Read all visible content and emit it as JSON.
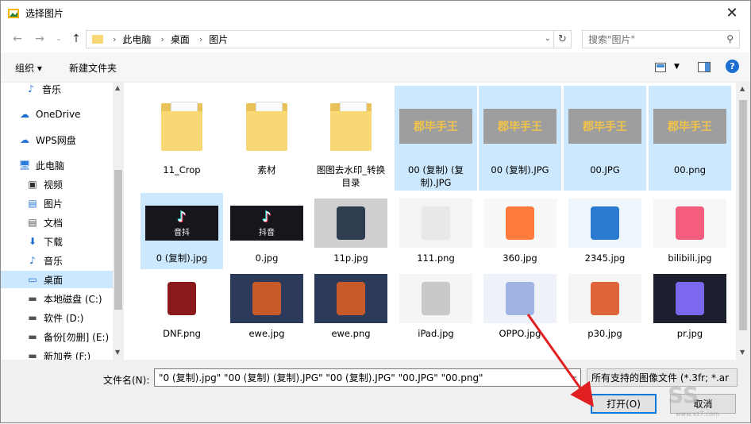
{
  "window": {
    "title": "选择图片"
  },
  "nav": {
    "breadcrumbs": [
      "此电脑",
      "桌面",
      "图片"
    ],
    "search_placeholder": "搜索\"图片\""
  },
  "toolbar": {
    "organize": "组织 ▾",
    "new_folder": "新建文件夹"
  },
  "sidebar": {
    "items": [
      {
        "label": "音乐",
        "icon": "music-icon"
      },
      {
        "label": "OneDrive",
        "icon": "cloud-icon"
      },
      {
        "label": "WPS网盘",
        "icon": "wps-cloud-icon"
      },
      {
        "label": "此电脑",
        "icon": "computer-icon"
      },
      {
        "label": "视频",
        "icon": "video-icon"
      },
      {
        "label": "图片",
        "icon": "pictures-icon"
      },
      {
        "label": "文档",
        "icon": "documents-icon"
      },
      {
        "label": "下载",
        "icon": "download-icon"
      },
      {
        "label": "音乐",
        "icon": "music-icon"
      },
      {
        "label": "桌面",
        "icon": "desktop-icon",
        "selected": true
      },
      {
        "label": "本地磁盘 (C:)",
        "icon": "drive-icon"
      },
      {
        "label": "软件 (D:)",
        "icon": "drive-icon"
      },
      {
        "label": "备份[勿删] (E:)",
        "icon": "drive-icon"
      },
      {
        "label": "新加卷 (F:)",
        "icon": "drive-icon"
      }
    ]
  },
  "files": [
    {
      "name": "11_Crop",
      "kind": "folder",
      "selected": false
    },
    {
      "name": "素材",
      "kind": "folder",
      "selected": false
    },
    {
      "name": "图图去水印_转换目录",
      "kind": "folder",
      "selected": false
    },
    {
      "name": "00 (复制) (复制).JPG",
      "kind": "logo",
      "selected": true
    },
    {
      "name": "00 (复制).JPG",
      "kind": "logo",
      "selected": true
    },
    {
      "name": "00.JPG",
      "kind": "logo",
      "selected": true
    },
    {
      "name": "00.png",
      "kind": "logo",
      "selected": true
    },
    {
      "name": "0 (复制).jpg",
      "kind": "tiktok",
      "selected": true
    },
    {
      "name": "0.jpg",
      "kind": "tiktok",
      "selected": false
    },
    {
      "name": "11p.jpg",
      "kind": "photo-phone-dark",
      "selected": false
    },
    {
      "name": "111.png",
      "kind": "photo-phones-color",
      "selected": false
    },
    {
      "name": "360.jpg",
      "kind": "photo-360",
      "selected": false
    },
    {
      "name": "2345.jpg",
      "kind": "photo-2345",
      "selected": false
    },
    {
      "name": "bilibili.jpg",
      "kind": "photo-bili",
      "selected": false
    },
    {
      "name": "DNF.png",
      "kind": "photo-dnf",
      "selected": false
    },
    {
      "name": "ewe.jpg",
      "kind": "photo-game",
      "selected": false
    },
    {
      "name": "ewe.png",
      "kind": "photo-game",
      "selected": false
    },
    {
      "name": "iPad.jpg",
      "kind": "photo-ipad",
      "selected": false
    },
    {
      "name": "OPPO.jpg",
      "kind": "photo-oppo",
      "selected": false
    },
    {
      "name": "p30.jpg",
      "kind": "photo-p30",
      "selected": false
    },
    {
      "name": "pr.jpg",
      "kind": "photo-pr",
      "selected": false
    }
  ],
  "logo_text": "郡毕手王",
  "tiktok_text": "抖音",
  "tiktok_text_mirrored": "音抖",
  "bottom": {
    "filename_label": "文件名(N):",
    "filename_value": "\"0 (复制).jpg\" \"00 (复制) (复制).JPG\" \"00 (复制).JPG\" \"00.JPG\" \"00.png\"",
    "filter_value": "所有支持的图像文件 (*.3fr; *.ar",
    "open_label": "打开(O)",
    "cancel_label": "取消"
  },
  "watermark": {
    "text": "SS",
    "site": "www.xz7.com"
  },
  "colors": {
    "selection": "#cce8ff",
    "accent": "#0078d7",
    "arrow": "#e02020"
  }
}
